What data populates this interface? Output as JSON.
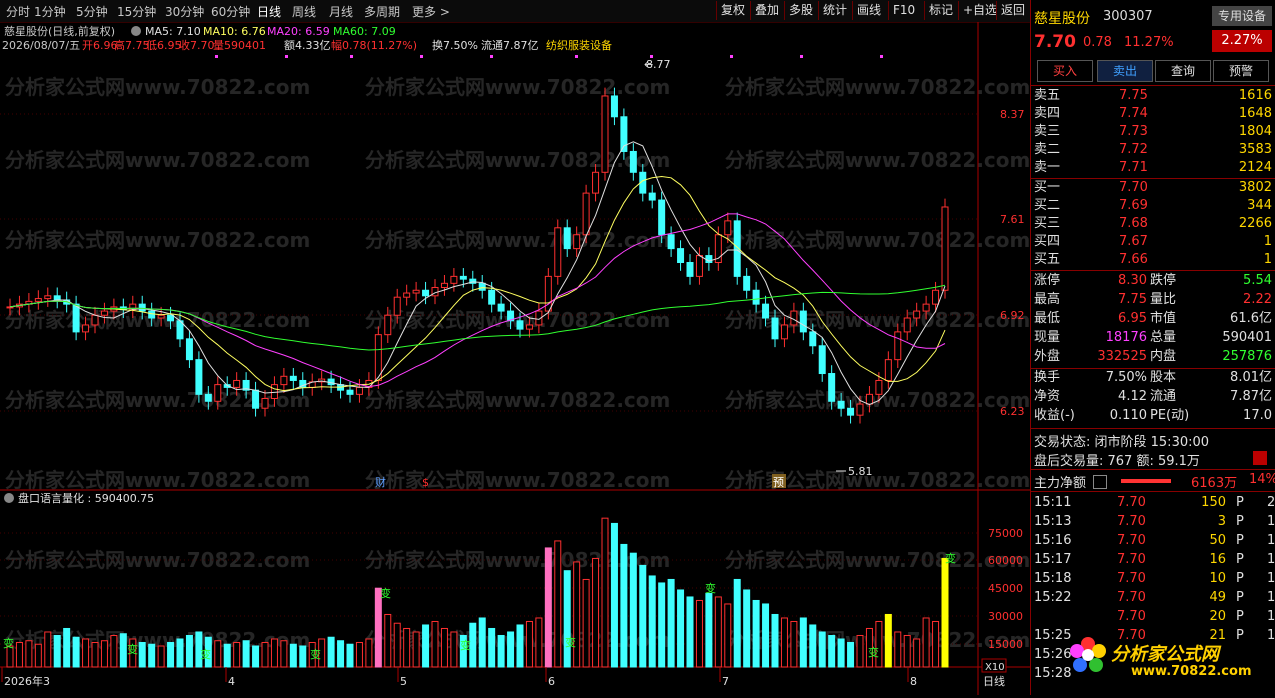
{
  "toolbar": {
    "periods": [
      "分时",
      "1分钟",
      "5分钟",
      "15分钟",
      "30分钟",
      "60分钟",
      "日线",
      "周线",
      "月线",
      "多周期",
      "更多 >"
    ],
    "active_period": "日线",
    "right_buttons": [
      "复权",
      "叠加",
      "多股",
      "统计",
      "画线",
      "F10",
      "标记",
      "+自选",
      "返回"
    ]
  },
  "info": {
    "title_line": "慈星股份(日线,前复权)",
    "ma5": "MA5: 7.10",
    "ma10": "MA10: 6.76",
    "ma20": "MA20: 6.59",
    "ma60": "MA60: 7.09",
    "date": "2026/08/07/五",
    "open": "开6.96",
    "high": "高7.75",
    "low": "低6.95",
    "close": "收7.70",
    "vol": "量590401",
    "amount": "额4.33亿",
    "change": "幅0.78(11.27%)",
    "turnover": "换7.50%",
    "float": "流通7.87亿",
    "sector": "纺织服装设备"
  },
  "price_axis": [
    "8.37",
    "7.61",
    "6.92",
    "6.23"
  ],
  "annotations": {
    "high": "8.77",
    "low": "5.81",
    "cai": "财",
    "s": "$",
    "yu": "预"
  },
  "volume_panel": {
    "title": "盘口语言量化 : 590400.75",
    "axis": [
      "75000",
      "60000",
      "45000",
      "30000",
      "15000"
    ],
    "x_labels": [
      "2026年3",
      "4",
      "5",
      "6",
      "7",
      "8"
    ],
    "period_label": "日线",
    "zoom": "X10",
    "marker": "变"
  },
  "watermark": "分析家公式网www.70822.com",
  "stock": {
    "name": "慈星股份",
    "code": "300307",
    "tag": "专用设备",
    "tag_pct": "2.27%",
    "price": "7.70",
    "change": "0.78",
    "pct": "11.27%"
  },
  "actions": [
    "买入",
    "卖出",
    "查询",
    "预警"
  ],
  "asks": [
    {
      "label": "卖五",
      "price": "7.75",
      "vol": "1616"
    },
    {
      "label": "卖四",
      "price": "7.74",
      "vol": "1648"
    },
    {
      "label": "卖三",
      "price": "7.73",
      "vol": "1804"
    },
    {
      "label": "卖二",
      "price": "7.72",
      "vol": "3583"
    },
    {
      "label": "卖一",
      "price": "7.71",
      "vol": "2124"
    }
  ],
  "bids": [
    {
      "label": "买一",
      "price": "7.70",
      "vol": "3802"
    },
    {
      "label": "买二",
      "price": "7.69",
      "vol": "344"
    },
    {
      "label": "买三",
      "price": "7.68",
      "vol": "2266"
    },
    {
      "label": "买四",
      "price": "7.67",
      "vol": "1"
    },
    {
      "label": "买五",
      "price": "7.66",
      "vol": "1"
    }
  ],
  "stats": [
    {
      "l1": "涨停",
      "v1": "8.30",
      "c1": "#ff3030",
      "l2": "跌停",
      "v2": "5.54",
      "c2": "#30ff30"
    },
    {
      "l1": "最高",
      "v1": "7.75",
      "c1": "#ff3030",
      "l2": "量比",
      "v2": "2.22",
      "c2": "#ff3030"
    },
    {
      "l1": "最低",
      "v1": "6.95",
      "c1": "#ff3030",
      "l2": "市值",
      "v2": "61.6亿",
      "c2": "#e0e0e0"
    },
    {
      "l1": "现量",
      "v1": "18176",
      "c1": "#ff40ff",
      "l2": "总量",
      "v2": "590401",
      "c2": "#e0e0e0"
    },
    {
      "l1": "外盘",
      "v1": "332525",
      "c1": "#ff3030",
      "l2": "内盘",
      "v2": "257876",
      "c2": "#30ff30"
    }
  ],
  "stats2": [
    {
      "l1": "换手",
      "v1": "7.50%",
      "l2": "股本",
      "v2": "8.01亿"
    },
    {
      "l1": "净资",
      "v1": "4.12",
      "l2": "流通",
      "v2": "7.87亿"
    },
    {
      "l1": "收益(-)",
      "v1": "0.110",
      "l2": "PE(动)",
      "v2": "17.0"
    }
  ],
  "status": {
    "line1": "交易状态: 闭市阶段 15:30:00",
    "line2": "盘后交易量: 767  额: 59.1万"
  },
  "capital": {
    "label": "主力净额",
    "value": "6163万",
    "pct": "14%"
  },
  "ticks": [
    {
      "t": "15:11",
      "p": "7.70",
      "v": "150",
      "d": "P",
      "n": "2"
    },
    {
      "t": "15:13",
      "p": "7.70",
      "v": "3",
      "d": "P",
      "n": "1"
    },
    {
      "t": "15:16",
      "p": "7.70",
      "v": "50",
      "d": "P",
      "n": "1"
    },
    {
      "t": "15:17",
      "p": "7.70",
      "v": "16",
      "d": "P",
      "n": "1"
    },
    {
      "t": "15:18",
      "p": "7.70",
      "v": "10",
      "d": "P",
      "n": "1"
    },
    {
      "t": "15:22",
      "p": "7.70",
      "v": "49",
      "d": "P",
      "n": "1"
    },
    {
      "t": "",
      "p": "7.70",
      "v": "20",
      "d": "P",
      "n": "1"
    },
    {
      "t": "15:25",
      "p": "7.70",
      "v": "21",
      "d": "P",
      "n": "1"
    },
    {
      "t": "15:26",
      "p": "",
      "v": "",
      "d": "",
      "n": ""
    },
    {
      "t": "15:28",
      "p": "",
      "v": "",
      "d": "",
      "n": ""
    }
  ],
  "logo": "分析家公式网",
  "logo_url": "www.70822.com"
}
